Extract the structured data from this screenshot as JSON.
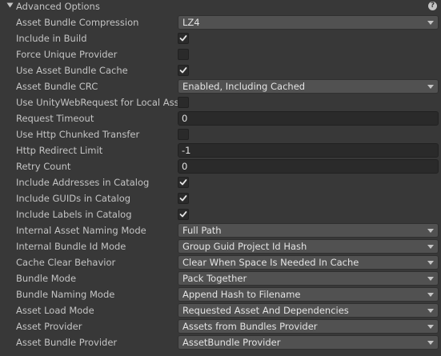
{
  "header": {
    "title": "Advanced Options",
    "help_glyph": "?"
  },
  "rows": [
    {
      "label": "Asset Bundle Compression",
      "type": "dropdown",
      "value": "LZ4"
    },
    {
      "label": "Include in Build",
      "type": "checkbox",
      "checked": true
    },
    {
      "label": "Force Unique Provider",
      "type": "checkbox",
      "checked": false
    },
    {
      "label": "Use Asset Bundle Cache",
      "type": "checkbox",
      "checked": true
    },
    {
      "label": "Asset Bundle CRC",
      "type": "dropdown",
      "value": "Enabled, Including Cached"
    },
    {
      "label": "Use UnityWebRequest for Local Ass",
      "type": "checkbox",
      "checked": false
    },
    {
      "label": "Request Timeout",
      "type": "text",
      "value": "0"
    },
    {
      "label": "Use Http Chunked Transfer",
      "type": "checkbox",
      "checked": false
    },
    {
      "label": "Http Redirect Limit",
      "type": "text",
      "value": "-1"
    },
    {
      "label": "Retry Count",
      "type": "text",
      "value": "0"
    },
    {
      "label": "Include Addresses in Catalog",
      "type": "checkbox",
      "checked": true
    },
    {
      "label": "Include GUIDs in Catalog",
      "type": "checkbox",
      "checked": true
    },
    {
      "label": "Include Labels in Catalog",
      "type": "checkbox",
      "checked": true
    },
    {
      "label": "Internal Asset Naming Mode",
      "type": "dropdown",
      "value": "Full Path"
    },
    {
      "label": "Internal Bundle Id Mode",
      "type": "dropdown",
      "value": "Group Guid Project Id Hash"
    },
    {
      "label": "Cache Clear Behavior",
      "type": "dropdown",
      "value": "Clear When Space Is Needed In Cache"
    },
    {
      "label": "Bundle Mode",
      "type": "dropdown",
      "value": "Pack Together"
    },
    {
      "label": "Bundle Naming Mode",
      "type": "dropdown",
      "value": "Append Hash to Filename"
    },
    {
      "label": "Asset Load Mode",
      "type": "dropdown",
      "value": "Requested Asset And Dependencies"
    },
    {
      "label": "Asset Provider",
      "type": "dropdown",
      "value": "Assets from Bundles Provider"
    },
    {
      "label": "Asset Bundle Provider",
      "type": "dropdown",
      "value": "AssetBundle Provider"
    }
  ],
  "icons": {
    "foldout": "foldout-expanded-icon",
    "help": "help-icon",
    "dropdown": "chevron-down-icon",
    "check": "checkmark-icon"
  }
}
